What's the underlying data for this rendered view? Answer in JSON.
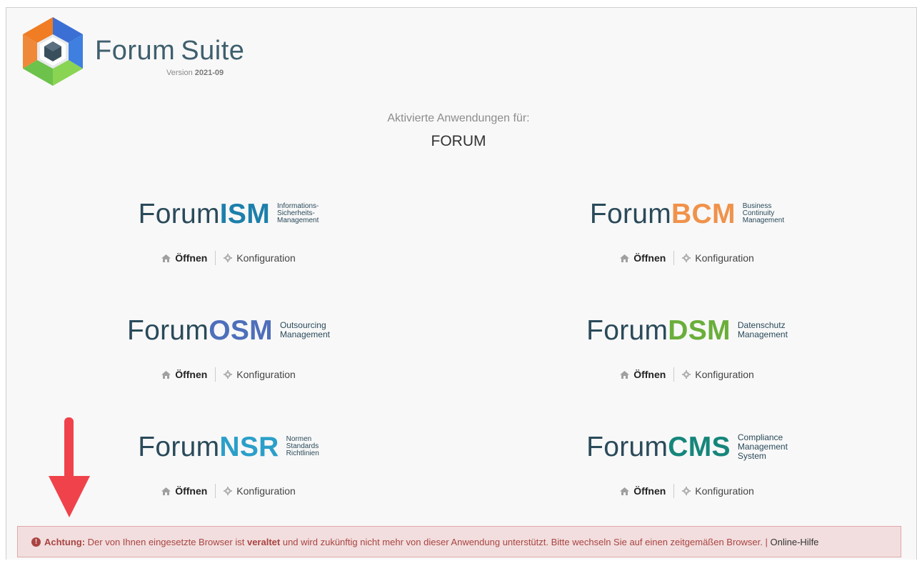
{
  "brand": {
    "name_part1": "Forum",
    "name_part2": "Suite",
    "version_label": "Version",
    "version_value": "2021-09"
  },
  "headings": {
    "activated": "Aktivierte Anwendungen für:",
    "tenant": "FORUM"
  },
  "apps": [
    {
      "prefix": "Forum",
      "suffix": "ISM",
      "color": "#1d7fab",
      "subtitle": [
        "Informations-",
        "Sicherheits-",
        "Management"
      ]
    },
    {
      "prefix": "Forum",
      "suffix": "BCM",
      "color": "#f0924a",
      "subtitle": [
        "Business",
        "Continuity",
        "Management"
      ]
    },
    {
      "prefix": "Forum",
      "suffix": "OSM",
      "color": "#4e6fba",
      "subtitle": [
        "Outsourcing",
        "Management"
      ]
    },
    {
      "prefix": "Forum",
      "suffix": "DSM",
      "color": "#6aae3a",
      "subtitle": [
        "Datenschutz",
        "Management"
      ]
    },
    {
      "prefix": "Forum",
      "suffix": "NSR",
      "color": "#2b9fc9",
      "subtitle": [
        "Normen",
        "Standards",
        "Richtlinien"
      ]
    },
    {
      "prefix": "Forum",
      "suffix": "CMS",
      "color": "#16867b",
      "subtitle": [
        "Compliance",
        "Management",
        "System"
      ]
    }
  ],
  "actions": {
    "open": "Öffnen",
    "config": "Konfiguration"
  },
  "alert": {
    "lead": "Achtung:",
    "text1": "Der von Ihnen eingesetzte Browser ist",
    "emph": "veraltet",
    "text2": "und wird zukünftig nicht mehr von dieser Anwendung unterstützt. Bitte wechseln Sie auf einen zeitgemäßen Browser. |",
    "link": "Online-Hilfe"
  },
  "colors": {
    "alert_bg": "#f2dede",
    "alert_text": "#a94442",
    "arrow": "#f0424a"
  }
}
